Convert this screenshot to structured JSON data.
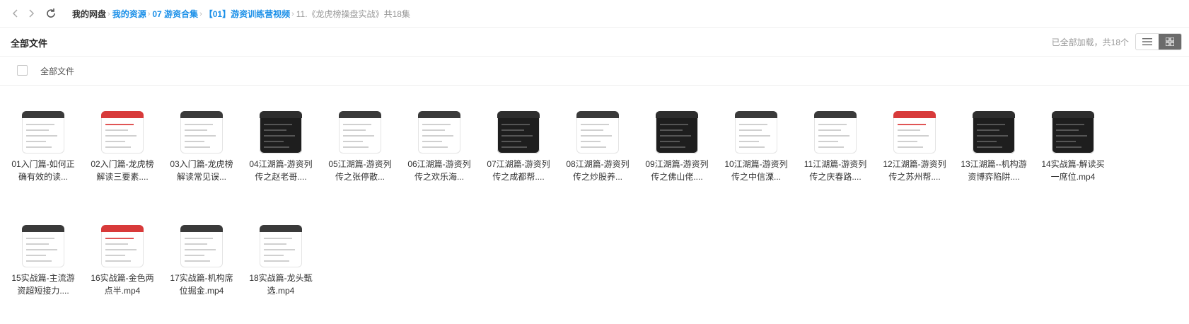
{
  "breadcrumb": {
    "root": "我的网盘",
    "links": [
      "我的资源",
      "07 游资合集",
      "【01】游资训练营视频"
    ],
    "current": "11.《龙虎榜操盘实战》",
    "count_text": "共18集"
  },
  "header": {
    "title": "全部文件",
    "status": "已全部加载，共18个"
  },
  "select_all_label": "全部文件",
  "files": [
    {
      "name": "01入门篇-如何正确有效的读..."
    },
    {
      "name": "02入门篇-龙虎榜解读三要素...."
    },
    {
      "name": "03入门篇-龙虎榜解读常见误..."
    },
    {
      "name": "04江湖篇-游资列传之赵老哥...."
    },
    {
      "name": "05江湖篇-游资列传之张停散..."
    },
    {
      "name": "06江湖篇-游资列传之欢乐海..."
    },
    {
      "name": "07江湖篇-游资列传之成都帮...."
    },
    {
      "name": "08江湖篇-游资列传之炒股养..."
    },
    {
      "name": "09江湖篇-游资列传之佛山佬...."
    },
    {
      "name": "10江湖篇-游资列传之中信溧..."
    },
    {
      "name": "11江湖篇-游资列传之庆春路...."
    },
    {
      "name": "12江湖篇-游资列传之苏州帮...."
    },
    {
      "name": "13江湖篇--机构游资博弈陷阱...."
    },
    {
      "name": "14实战篇-解读买一席位.mp4"
    },
    {
      "name": "15实战篇-主流游资超短接力...."
    },
    {
      "name": "16实战篇-金色两点半.mp4"
    },
    {
      "name": "17实战篇-机构席位掘金.mp4"
    },
    {
      "name": "18实战篇-龙头甄选.mp4"
    }
  ],
  "icons": {
    "back": "chevron-left-icon",
    "forward": "chevron-right-icon",
    "refresh": "refresh-icon",
    "list_view": "list-view-icon",
    "grid_view": "grid-view-icon"
  }
}
